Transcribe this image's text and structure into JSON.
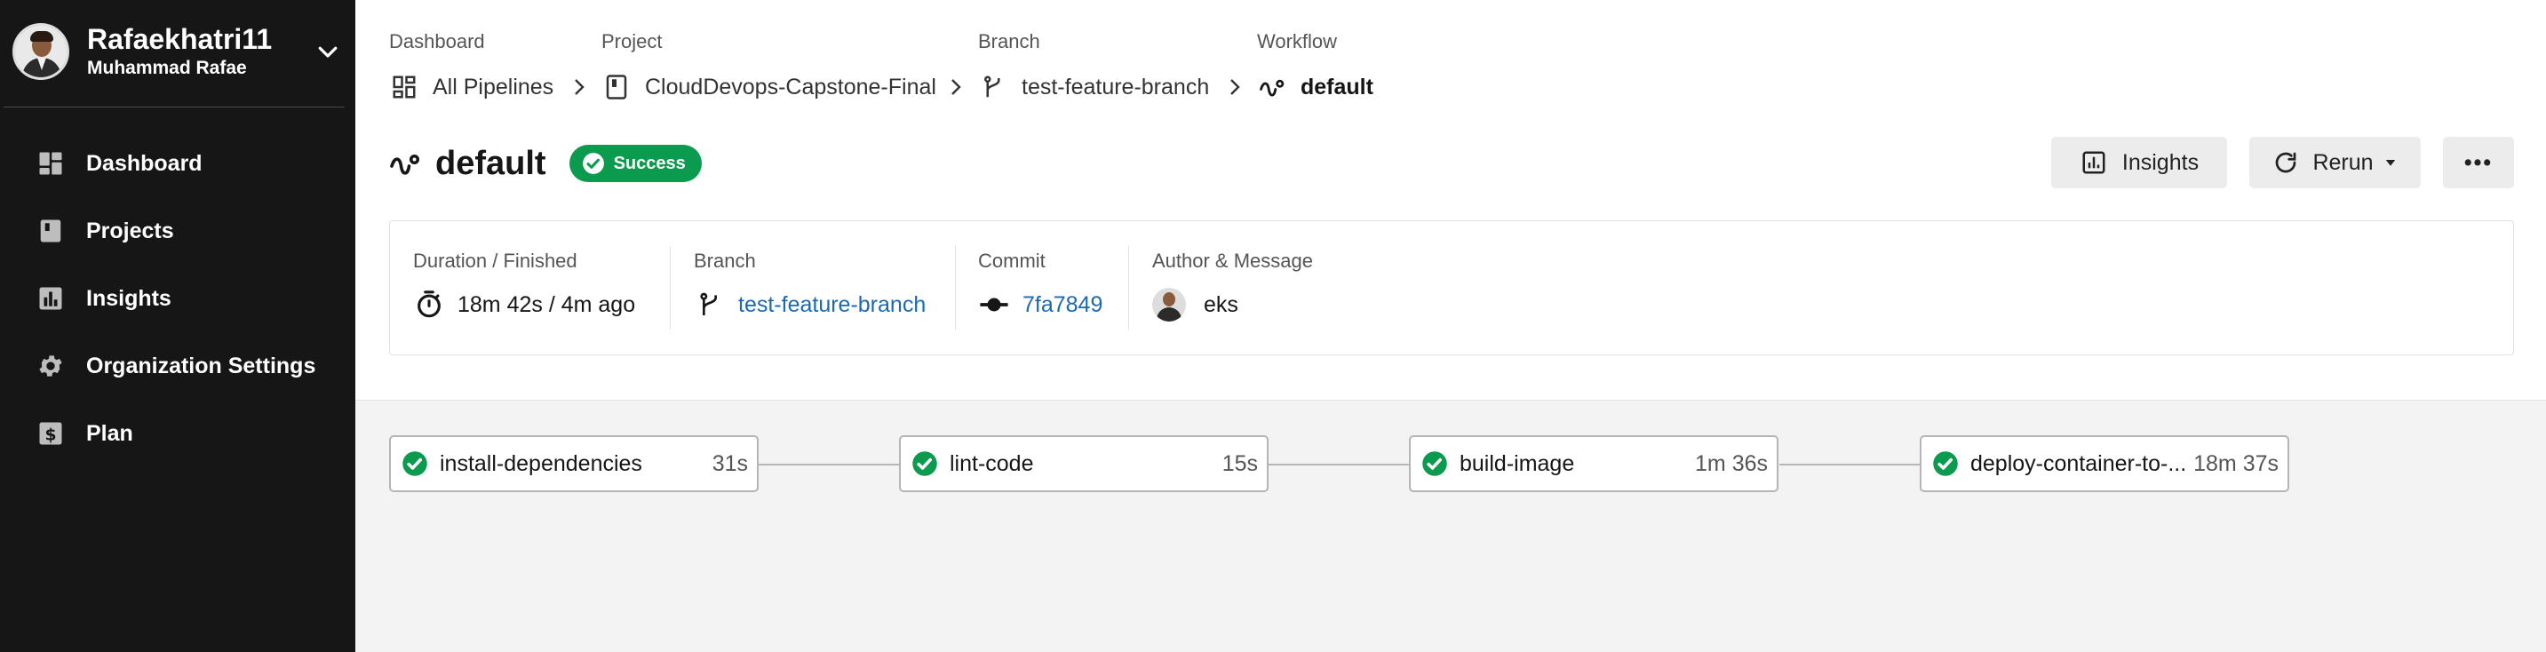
{
  "sidebar": {
    "user_login": "Rafaekhatri11",
    "user_name": "Muhammad Rafae",
    "items": [
      {
        "label": "Dashboard",
        "icon": "dashboard-icon"
      },
      {
        "label": "Projects",
        "icon": "projects-icon"
      },
      {
        "label": "Insights",
        "icon": "insights-icon"
      },
      {
        "label": "Organization Settings",
        "icon": "gear-icon"
      },
      {
        "label": "Plan",
        "icon": "plan-icon"
      }
    ]
  },
  "breadcrumb": {
    "labels": [
      "Dashboard",
      "Project",
      "Branch",
      "Workflow"
    ],
    "items": [
      {
        "text": "All Pipelines",
        "icon": "pipelines-icon"
      },
      {
        "text": "CloudDevops-Capstone-Final",
        "icon": "project-icon"
      },
      {
        "text": "test-feature-branch",
        "icon": "branch-icon"
      },
      {
        "text": "default",
        "icon": "workflow-icon"
      }
    ]
  },
  "workflow": {
    "title": "default",
    "status": "Success",
    "status_color": "#0a9b4f"
  },
  "actions": {
    "insights_label": "Insights",
    "rerun_label": "Rerun",
    "more_label": "•••"
  },
  "summary": {
    "duration_label": "Duration / Finished",
    "duration_value": "18m 42s / 4m ago",
    "branch_label": "Branch",
    "branch_value": "test-feature-branch",
    "commit_label": "Commit",
    "commit_value": "7fa7849",
    "author_label": "Author & Message",
    "author_message": "eks"
  },
  "jobs": [
    {
      "name": "install-dependencies",
      "duration": "31s",
      "status": "success"
    },
    {
      "name": "lint-code",
      "duration": "15s",
      "status": "success"
    },
    {
      "name": "build-image",
      "duration": "1m 36s",
      "status": "success"
    },
    {
      "name": "deploy-container-to-...",
      "duration": "18m 37s",
      "status": "success"
    }
  ],
  "colors": {
    "sidebar_bg": "#161616",
    "success": "#0a9b4f",
    "link": "#1b6ab1"
  }
}
